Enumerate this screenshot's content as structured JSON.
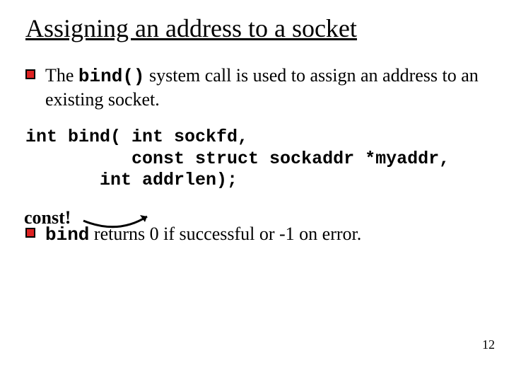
{
  "slide": {
    "title": "Assigning an address to a socket",
    "bullets": [
      {
        "pre": "The ",
        "code": "bind()",
        "post": " system call is used to assign an address to an existing socket."
      },
      {
        "preCode": "bind",
        "post": " returns 0 if successful or -1 on error."
      }
    ],
    "code": "int bind( int sockfd,\n          const struct sockaddr *myaddr,\n       int addrlen);",
    "callout": "const!",
    "pageNumber": "12"
  }
}
